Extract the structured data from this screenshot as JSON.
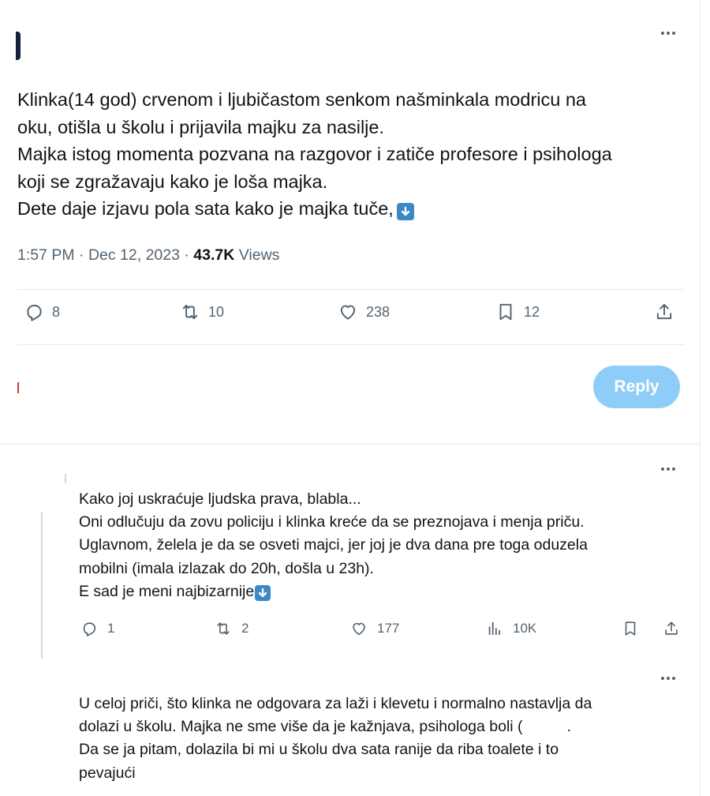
{
  "tweet": {
    "text_lines": [
      "Klinka(14 god) crvenom i ljubičastom senkom našminkala modricu na",
      "oku, otišla u školu i prijavila majku za nasilje.",
      "Majka istog momenta pozvana na razgovor i zatiče profesore i psihologa",
      "koji se zgražavaju kako je loša majka.",
      "Dete daje izjavu pola sata kako je majka tuče,"
    ],
    "emoji": "arrow-down-emoji",
    "time": "1:57 PM · Dec 12, 2023 · ",
    "views_count": "43.7K",
    "views_label": " Views",
    "stats": {
      "replies": "8",
      "retweets": "10",
      "likes": "238",
      "bookmarks": "12"
    }
  },
  "composer": {
    "reply_button": "Reply"
  },
  "reply1": {
    "text_lines": [
      "Kako joj uskraćuje ljudska prava, blabla...",
      "Oni odlučuju da zovu policiju i klinka kreće da se preznojava i menja priču.",
      "Uglavnom, želela je da se osveti majci, jer joj je dva dana pre toga oduzela",
      "mobilni (imala izlazak do 20h, došla u 23h).",
      "E sad je meni najbizarnije"
    ],
    "stats": {
      "replies": "1",
      "retweets": "2",
      "likes": "177",
      "views": "10K"
    }
  },
  "reply2": {
    "text_lines": [
      "U celoj priči, što klinka ne odgovara za laži i klevetu i normalno nastavlja da",
      "dolazi u školu. Majka ne sme više da je kažnjava, psihologa boli (",
      "Da se ja pitam, dolazila bi mi u školu dva sata ranije da riba toalete i to",
      "pevajući"
    ],
    "trailing": "."
  },
  "colors": {
    "text": "#0f1419",
    "secondary": "#536471",
    "reply_button_disabled": "#8ecdf8",
    "emoji_blue": "#3b88c3",
    "divider": "#e6e9ec"
  }
}
